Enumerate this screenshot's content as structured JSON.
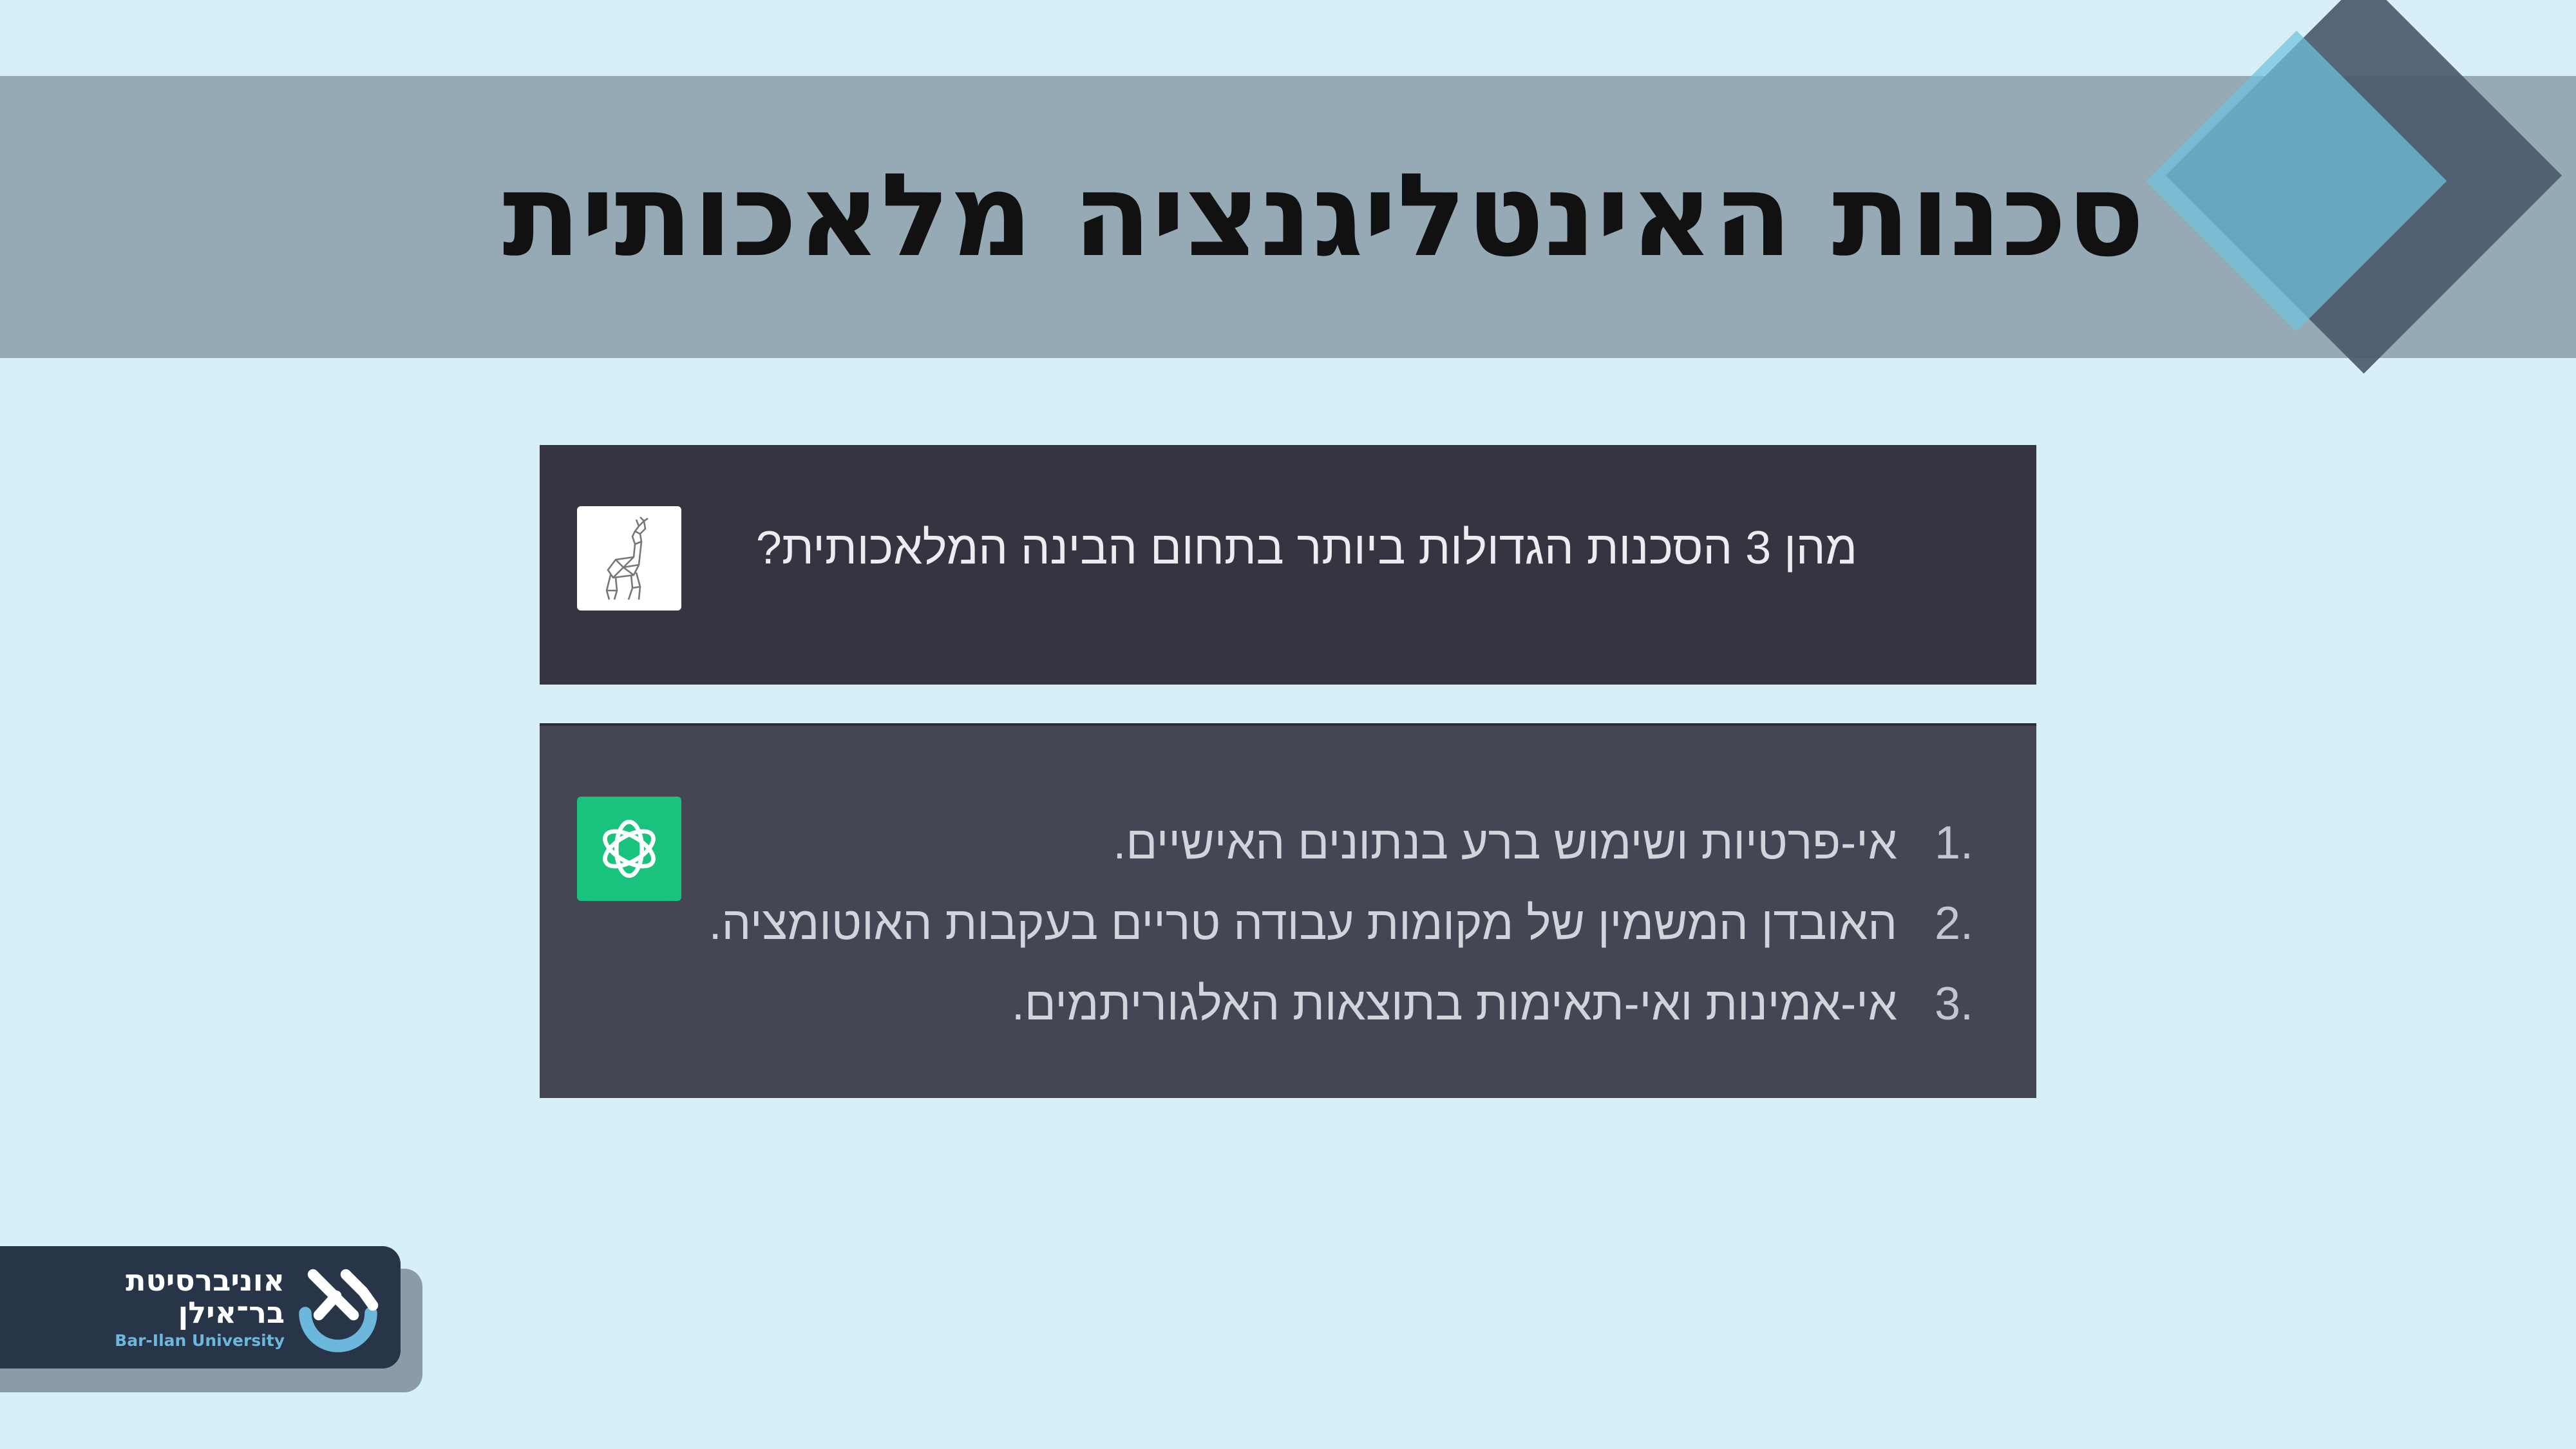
{
  "slide": {
    "title": "סכנות האינטליגנציה מלאכותית"
  },
  "chat": {
    "question": "מהן 3 הסכנות הגדולות ביותר בתחום הבינה המלאכותית?",
    "answers": [
      {
        "num": "1.",
        "text": "אי-פרטיות ושימוש ברע בנתונים האישיים."
      },
      {
        "num": "2.",
        "text": "האובדן המשמין של מקומות עבודה טריים בעקבות האוטומציה."
      },
      {
        "num": "3.",
        "text": "אי-אמינות ואי-תאימות בתוצאות האלגוריתמים."
      }
    ]
  },
  "logo": {
    "line1": "אוניברסיטת",
    "line2": "בר־אילן",
    "line3": "Bar-Ilan University"
  },
  "icons": {
    "user_avatar": "deer-avatar-icon",
    "assistant_avatar": "chatgpt-logo-icon"
  },
  "colors": {
    "background": "#d7eff7",
    "title_band": "#96aab5",
    "question_bg": "#353541",
    "answer_bg": "#444654",
    "assistant_green": "#19c37d",
    "diamond_dark": "#4c5b6d",
    "diamond_light": "#6fc2de",
    "logo_navy": "#283447",
    "logo_accent": "#6cb8dc"
  }
}
